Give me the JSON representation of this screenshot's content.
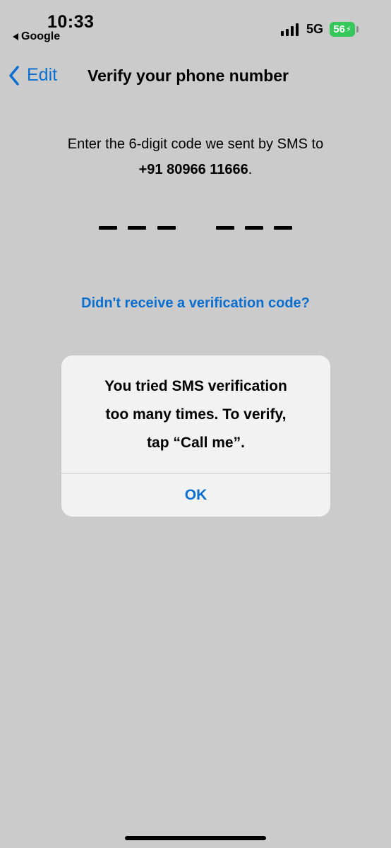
{
  "status_bar": {
    "time": "10:33",
    "back_app": "Google",
    "network": "5G",
    "battery": "56",
    "battery_color": "#35c759",
    "icons": [
      "signal-bars-icon",
      "battery-icon",
      "back-triangle-icon"
    ]
  },
  "nav": {
    "back_label": "Edit",
    "title": "Verify your phone number",
    "accent_color": "#0a6fd1"
  },
  "instruction": {
    "text": "Enter the 6-digit code we sent by SMS to",
    "phone": "+91 80966 11666",
    "suffix": "."
  },
  "code_input": {
    "digits": 6,
    "value": ""
  },
  "resend_link": "Didn't receive a verification code?",
  "alert": {
    "message_line1": "You tried SMS verification",
    "message_line2": "too many times. To verify,",
    "message_line3": "tap “Call me”.",
    "button": "OK"
  }
}
